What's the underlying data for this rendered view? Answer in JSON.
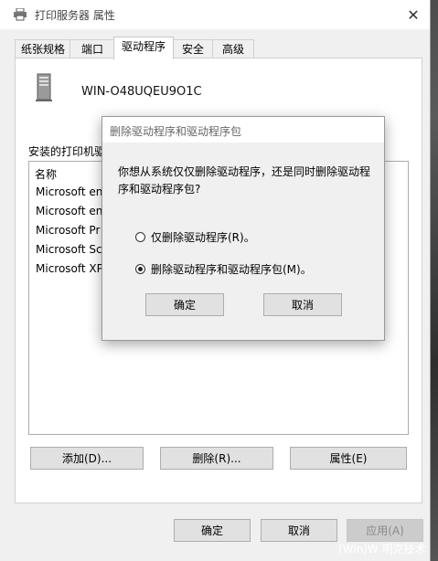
{
  "window": {
    "title": "打印服务器 属性",
    "close_glyph": "✕"
  },
  "tabs": [
    {
      "label": "纸张规格"
    },
    {
      "label": "端口"
    },
    {
      "label": "驱动程序",
      "active": true
    },
    {
      "label": "安全"
    },
    {
      "label": "高级"
    }
  ],
  "server": {
    "name": "WIN-O48UQEU9O1C"
  },
  "drivers": {
    "label": "安装的打印机驱",
    "column_header": "名称",
    "items": [
      "Microsoft en",
      "Microsoft en",
      "Microsoft Pr",
      "Microsoft Sc",
      "Microsoft XP"
    ]
  },
  "driver_buttons": {
    "add": "添加(D)...",
    "remove": "删除(R)...",
    "properties": "属性(E)"
  },
  "footer_buttons": {
    "ok": "确定",
    "cancel": "取消",
    "apply": "应用(A)"
  },
  "dialog": {
    "title": "删除驱动程序和驱动程序包",
    "message": "你想从系统仅仅删除驱动程序，还是同时删除驱动程序和驱动程序包?",
    "options": [
      {
        "label": "仅删除驱动程序(R)。",
        "selected": false
      },
      {
        "label": "删除驱动程序和驱动程序包(M)。",
        "selected": true
      }
    ],
    "ok": "确定",
    "cancel": "取消"
  },
  "watermark": "(Win)W 明克技术"
}
